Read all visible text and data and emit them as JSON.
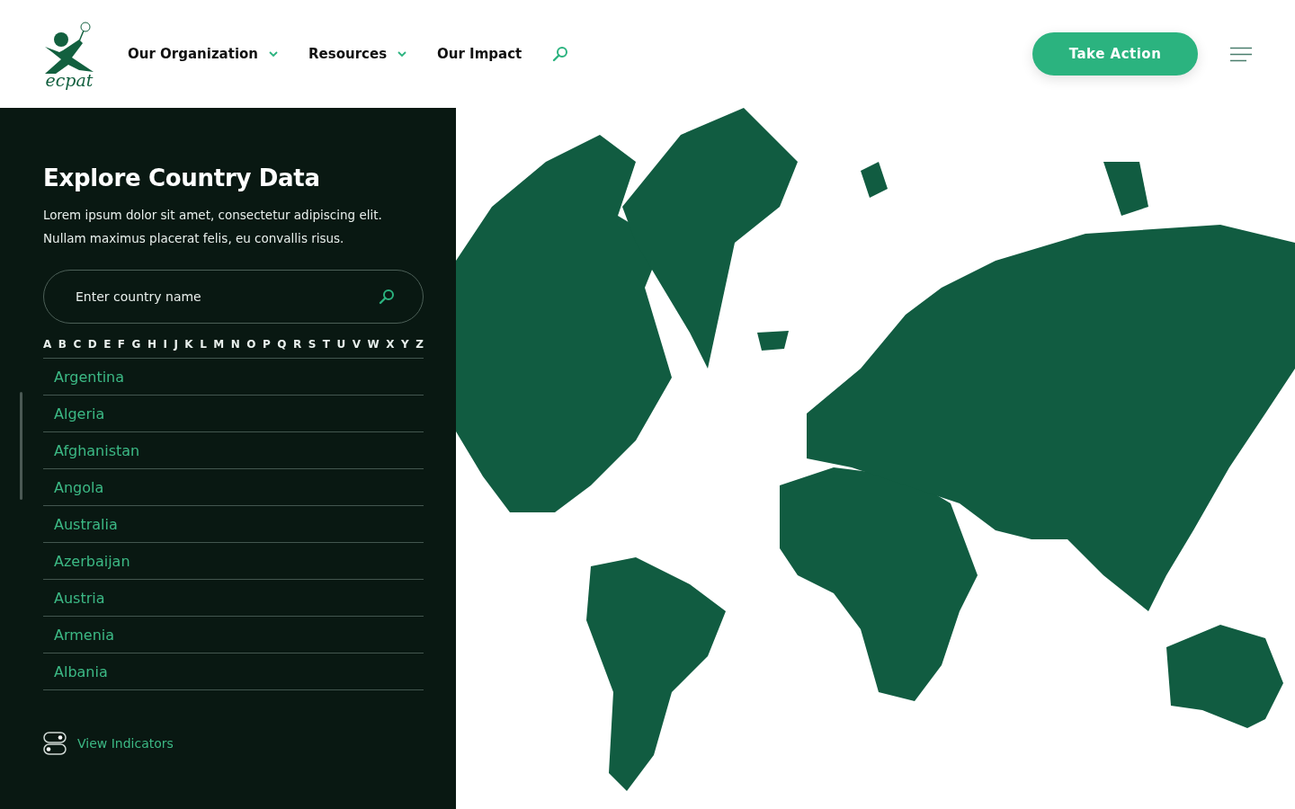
{
  "header": {
    "logo_text": "ecpat",
    "nav": [
      {
        "label": "Our Organization",
        "has_dropdown": true
      },
      {
        "label": "Resources",
        "has_dropdown": true
      },
      {
        "label": "Our Impact",
        "has_dropdown": false
      }
    ],
    "cta": "Take Action"
  },
  "panel": {
    "title": "Explore Country Data",
    "description": "Lorem ipsum dolor sit amet, consectetur adipiscing elit. Nullam maximus placerat felis, eu convallis risus.",
    "search": {
      "placeholder": "Enter country name"
    },
    "letters": [
      "A",
      "B",
      "C",
      "D",
      "E",
      "F",
      "G",
      "H",
      "I",
      "J",
      "K",
      "L",
      "M",
      "N",
      "O",
      "P",
      "Q",
      "R",
      "S",
      "T",
      "U",
      "V",
      "W",
      "X",
      "Y",
      "Z"
    ],
    "countries": [
      "Argentina",
      "Algeria",
      "Afghanistan",
      "Angola",
      "Australia",
      "Azerbaijan",
      "Austria",
      "Armenia",
      "Albania"
    ],
    "view_indicators": "View Indicators"
  }
}
